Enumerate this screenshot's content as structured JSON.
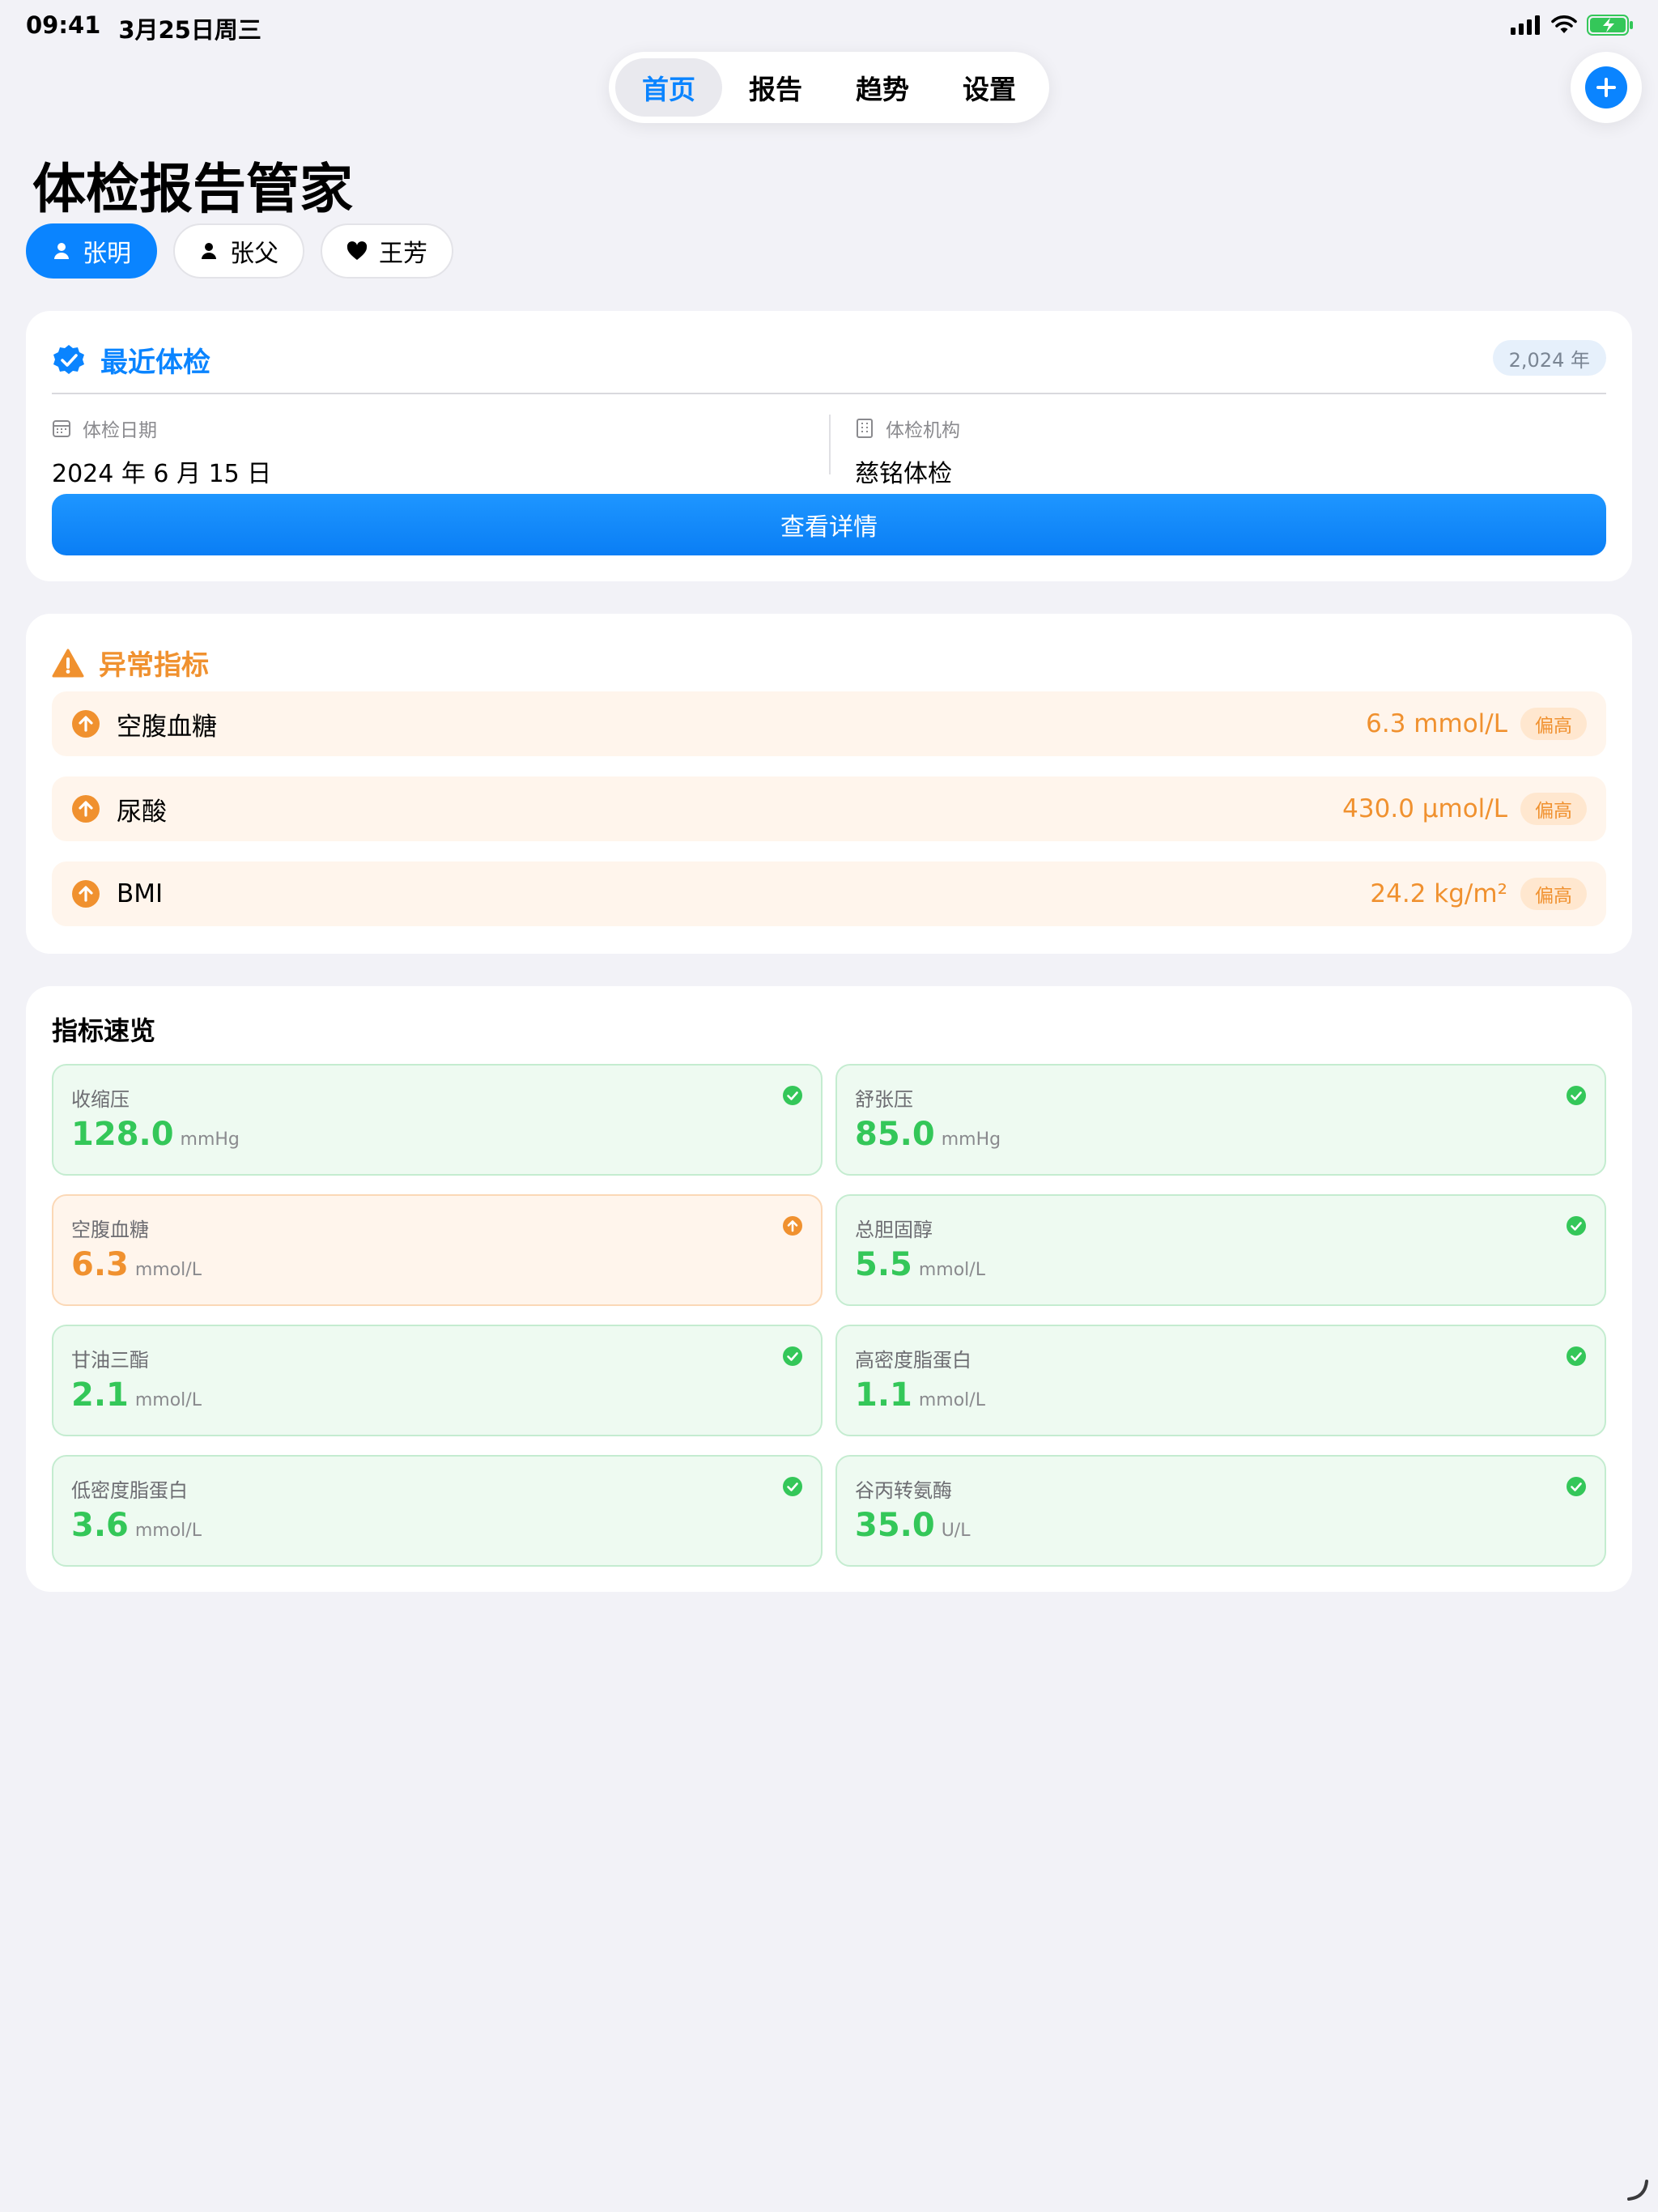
{
  "status_bar": {
    "time": "09:41",
    "date": "3月25日周三"
  },
  "nav": {
    "tabs": [
      {
        "label": "首页",
        "active": true
      },
      {
        "label": "报告",
        "active": false
      },
      {
        "label": "趋势",
        "active": false
      },
      {
        "label": "设置",
        "active": false
      }
    ],
    "add_icon": "plus-icon"
  },
  "page_title": "体检报告管家",
  "members": [
    {
      "name": "张明",
      "icon": "person-icon",
      "active": true
    },
    {
      "name": "张父",
      "icon": "person-icon",
      "active": false
    },
    {
      "name": "王芳",
      "icon": "heart-icon",
      "active": false
    }
  ],
  "recent_exam": {
    "title": "最近体检",
    "year": "2,024 年",
    "date_label": "体检日期",
    "date_value": "2024 年 6 月 15 日",
    "org_label": "体检机构",
    "org_value": "慈铭体检",
    "detail_button": "查看详情"
  },
  "abnormal": {
    "title": "异常指标",
    "items": [
      {
        "name": "空腹血糖",
        "value": "6.3 mmol/L",
        "badge": "偏高"
      },
      {
        "name": "尿酸",
        "value": "430.0 μmol/L",
        "badge": "偏高"
      },
      {
        "name": "BMI",
        "value": "24.2 kg/m²",
        "badge": "偏高"
      }
    ]
  },
  "overview": {
    "title": "指标速览",
    "metrics": [
      {
        "name": "收缩压",
        "value": "128.0",
        "unit": "mmHg",
        "status": "normal"
      },
      {
        "name": "舒张压",
        "value": "85.0",
        "unit": "mmHg",
        "status": "normal"
      },
      {
        "name": "空腹血糖",
        "value": "6.3",
        "unit": "mmol/L",
        "status": "high"
      },
      {
        "name": "总胆固醇",
        "value": "5.5",
        "unit": "mmol/L",
        "status": "normal"
      },
      {
        "name": "甘油三酯",
        "value": "2.1",
        "unit": "mmol/L",
        "status": "normal"
      },
      {
        "name": "高密度脂蛋白",
        "value": "1.1",
        "unit": "mmol/L",
        "status": "normal"
      },
      {
        "name": "低密度脂蛋白",
        "value": "3.6",
        "unit": "mmol/L",
        "status": "normal"
      },
      {
        "name": "谷丙转氨酶",
        "value": "35.0",
        "unit": "U/L",
        "status": "normal"
      }
    ]
  },
  "colors": {
    "accent": "#0a84ff",
    "warning": "#f0912f",
    "normal": "#34c759",
    "background": "#f2f2f7"
  }
}
